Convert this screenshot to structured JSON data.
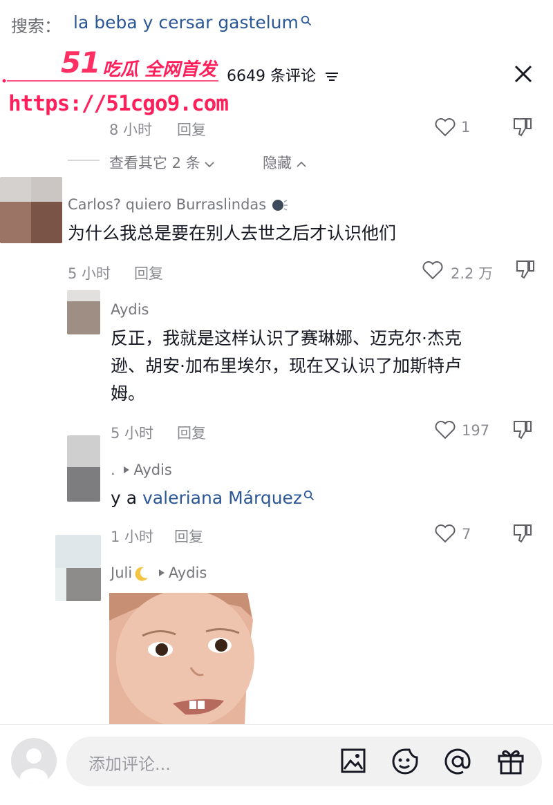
{
  "search": {
    "label": "搜索：",
    "query": "la beba y cersar gastelum"
  },
  "watermark": {
    "logo": "51",
    "title": "吃瓜 全网首发",
    "url": "https://51cgo9.com"
  },
  "header": {
    "count": "6649 条评论"
  },
  "top_reply": {
    "time": "8 小时",
    "reply": "回复",
    "likes": "1"
  },
  "more_replies": {
    "label": "查看其它 2 条",
    "hide": "隐藏"
  },
  "comment": {
    "username": "Carlos? quiero Burraslindas",
    "text": "为什么我总是要在别人去世之后才认识他们",
    "time": "5 小时",
    "reply": "回复",
    "likes": "2.2 万"
  },
  "replies": [
    {
      "username": "Aydis",
      "lines": [
        "反正，我就是这样认识了赛琳娜、迈克尔·杰克",
        "逊、胡安·加布里埃尔，现在又认识了加斯特卢",
        "姆。"
      ],
      "time": "5 小时",
      "reply": "回复",
      "likes": "197"
    },
    {
      "username": ".",
      "reply_to": "Aydis",
      "text_prefix": "y a ",
      "mention": "valeriana Márquez",
      "time": "1 小时",
      "reply": "回复",
      "likes": "7"
    },
    {
      "username": "Juli",
      "reply_to": "Aydis"
    }
  ],
  "input": {
    "placeholder": "添加评论..."
  },
  "colors": {
    "link": "#2b5797",
    "watermark": "#ff1f5a",
    "muted": "#8a8b91"
  }
}
